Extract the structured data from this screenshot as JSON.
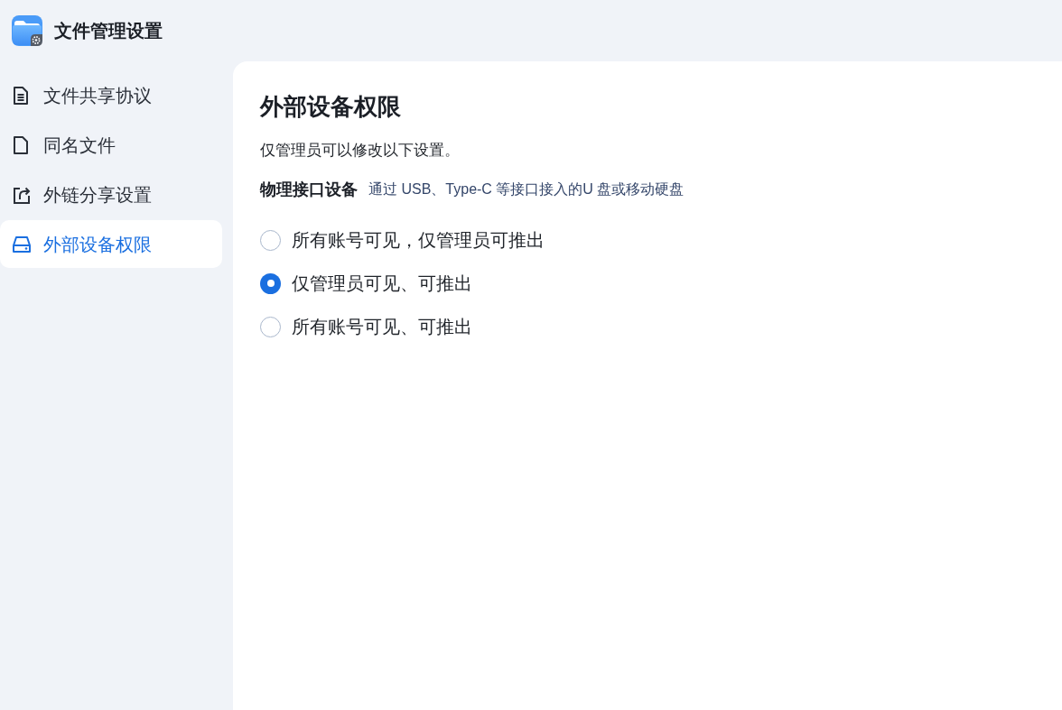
{
  "app": {
    "title": "文件管理设置"
  },
  "sidebar": {
    "items": [
      {
        "label": "文件共享协议",
        "selected": false
      },
      {
        "label": "同名文件",
        "selected": false
      },
      {
        "label": "外链分享设置",
        "selected": false
      },
      {
        "label": "外部设备权限",
        "selected": true
      }
    ]
  },
  "panel": {
    "title": "外部设备权限",
    "note": "仅管理员可以修改以下设置。",
    "section": {
      "label": "物理接口设备",
      "description": "通过 USB、Type-C 等接口接入的U 盘或移动硬盘"
    },
    "options": [
      {
        "label": "所有账号可见，仅管理员可推出",
        "selected": false
      },
      {
        "label": "仅管理员可见、可推出",
        "selected": true
      },
      {
        "label": "所有账号可见、可推出",
        "selected": false
      }
    ]
  }
}
